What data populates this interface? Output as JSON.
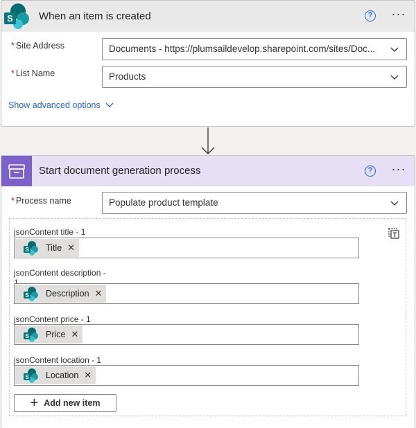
{
  "trigger_card": {
    "title": "When an item is created",
    "help_symbol": "?",
    "more_symbol": "···",
    "icon": "sharepoint-icon",
    "fields": [
      {
        "label": "Site Address",
        "value": "Documents - https://plumsaildevelop.sharepoint.com/sites/Doc..."
      },
      {
        "label": "List Name",
        "value": "Products"
      }
    ],
    "advanced_link": "Show advanced options"
  },
  "action_card": {
    "title": "Start document generation process",
    "help_symbol": "?",
    "more_symbol": "···",
    "icon": "document-generation-icon",
    "process_label": "Process name",
    "process_value": "Populate product template",
    "items": [
      {
        "label": "jsonContent title - 1",
        "token": "Title"
      },
      {
        "label": "jsonContent description - 1",
        "token": "Description"
      },
      {
        "label": "jsonContent price - 1",
        "token": "Price"
      },
      {
        "label": "jsonContent location - 1",
        "token": "Location"
      }
    ],
    "add_button": "Add new item"
  },
  "colors": {
    "accent": "#2266e3",
    "trigger_header": "#e9e9e9",
    "action_header": "#e5e0f5",
    "action_icon": "#7b61c9",
    "sharepoint_teal": "#038387",
    "required": "#a4262c"
  }
}
